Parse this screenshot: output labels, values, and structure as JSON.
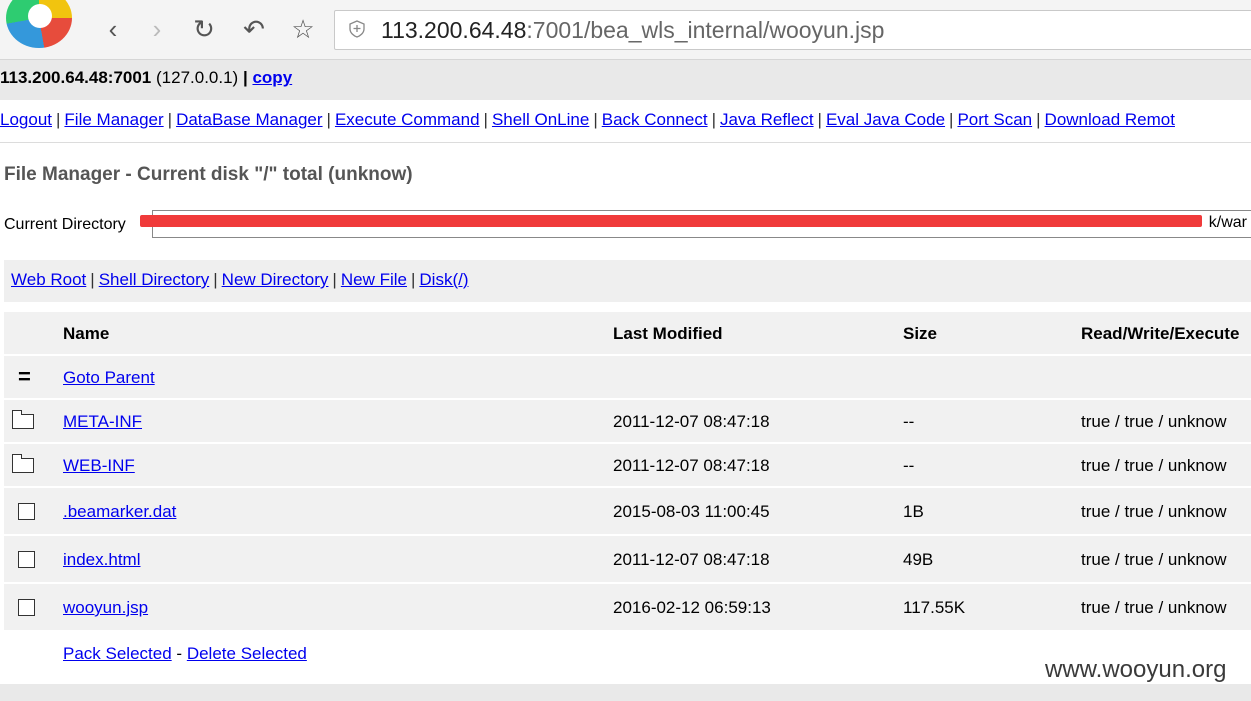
{
  "browser": {
    "url_host": "113.200.64.48",
    "url_rest": ":7001/bea_wls_internal/wooyun.jsp",
    "icons": [
      "back-icon",
      "forward-icon",
      "reload-icon",
      "undo-icon",
      "star-icon",
      "shield-icon"
    ]
  },
  "host": {
    "address": "113.200.64.48:7001",
    "local": "(127.0.0.1)",
    "sep": "|",
    "copy_label": "copy"
  },
  "menu": [
    "Logout",
    "File Manager",
    "DataBase Manager",
    "Execute Command",
    "Shell OnLine",
    "Back Connect",
    "Java Reflect",
    "Eval Java Code",
    "Port Scan",
    "Download Remot"
  ],
  "page_title": "File Manager - Current disk \"/\" total (unknow)",
  "current_directory": {
    "label": "Current Directory",
    "value_visible": "k/war"
  },
  "quick_links": [
    "Web Root",
    "Shell Directory",
    "New Directory",
    "New File",
    "Disk(/)"
  ],
  "table": {
    "headers": {
      "name": "Name",
      "modified": "Last Modified",
      "size": "Size",
      "rwx": "Read/Write/Execute"
    },
    "goto_parent": {
      "icon": "=",
      "label": "Goto Parent"
    },
    "rows": [
      {
        "type": "folder",
        "name": "META-INF",
        "modified": "2011-12-07 08:47:18",
        "size": "--",
        "rwx": "true / true / unknow"
      },
      {
        "type": "folder",
        "name": "WEB-INF",
        "modified": "2011-12-07 08:47:18",
        "size": "--",
        "rwx": "true / true / unknow"
      },
      {
        "type": "file",
        "name": ".beamarker.dat",
        "modified": "2015-08-03 11:00:45",
        "size": "1B",
        "rwx": "true / true / unknow"
      },
      {
        "type": "file",
        "name": "index.html",
        "modified": "2011-12-07 08:47:18",
        "size": "49B",
        "rwx": "true / true / unknow"
      },
      {
        "type": "file",
        "name": "wooyun.jsp",
        "modified": "2016-02-12 06:59:13",
        "size": "117.55K",
        "rwx": "true / true / unknow"
      }
    ],
    "footer": {
      "pack": "Pack Selected",
      "dash": "-",
      "delete": "Delete Selected"
    }
  },
  "watermark": "www.wooyun.org",
  "colors": {
    "link": "#0000ee",
    "redaction": "#f03a3a",
    "row_bg": "#f1f1f1",
    "hostbar_bg": "#e9e9e9"
  }
}
